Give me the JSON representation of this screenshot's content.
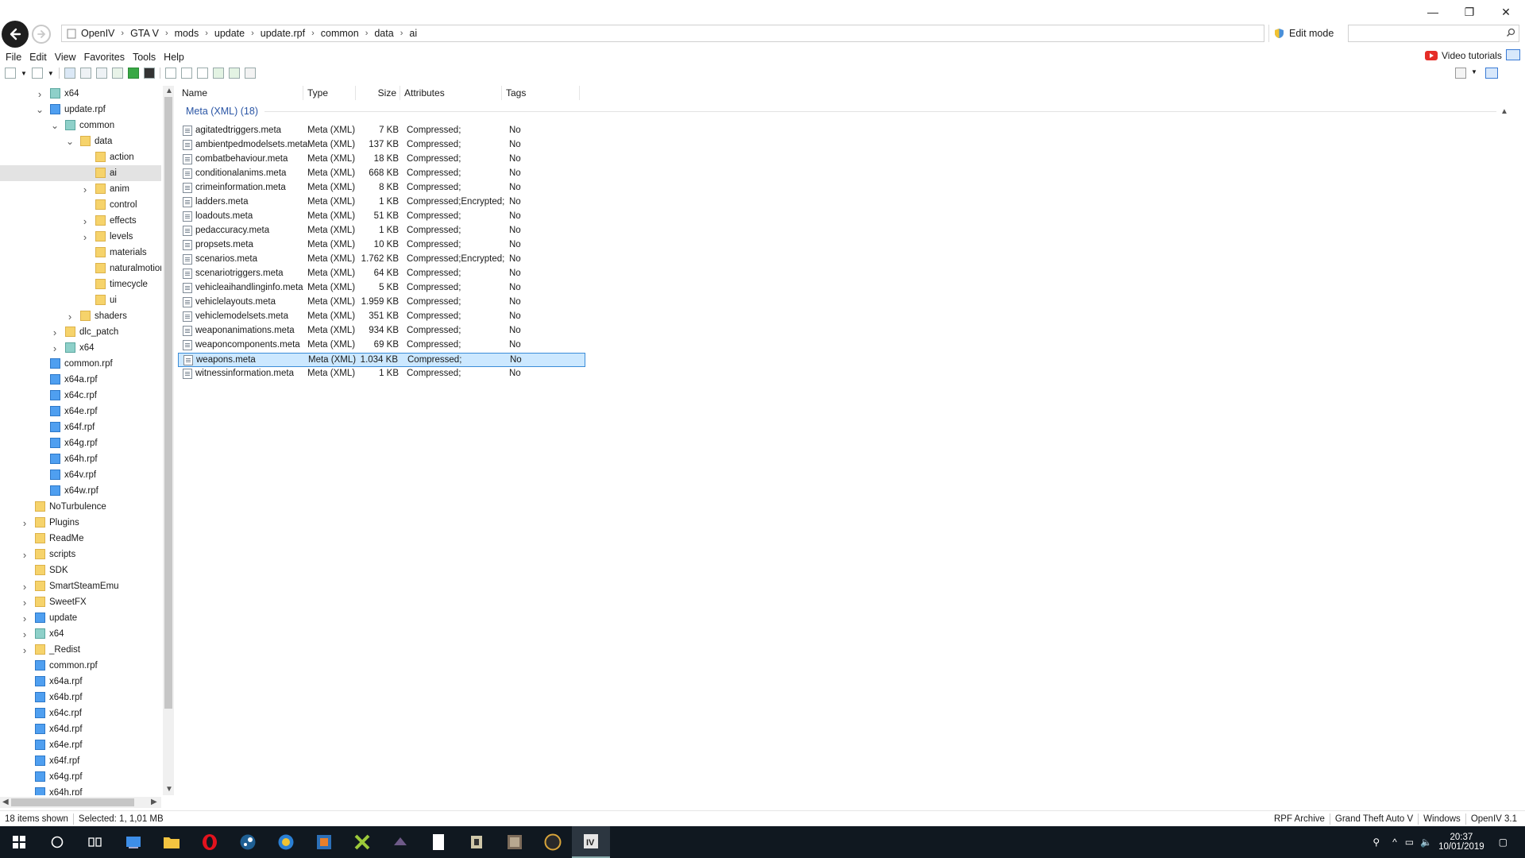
{
  "address": {
    "crumbs": [
      "OpenIV",
      "GTA V",
      "mods",
      "update",
      "update.rpf",
      "common",
      "data",
      "ai"
    ],
    "edit_mode_label": "Edit mode",
    "search_value": ""
  },
  "window_controls": {
    "minimize": "—",
    "restore": "❐",
    "close": "✕"
  },
  "menu": [
    "File",
    "Edit",
    "View",
    "Favorites",
    "Tools",
    "Help"
  ],
  "video_tutorials_label": "Video tutorials",
  "tree": [
    {
      "label": "x64",
      "indent": 1,
      "icon": "teal",
      "chevron": ">"
    },
    {
      "label": "update.rpf",
      "indent": 1,
      "icon": "rpf",
      "chevron": "v"
    },
    {
      "label": "common",
      "indent": 2,
      "icon": "teal",
      "chevron": "v"
    },
    {
      "label": "data",
      "indent": 3,
      "icon": "folder-open",
      "chevron": "v"
    },
    {
      "label": "action",
      "indent": 4,
      "icon": "folder",
      "chevron": ""
    },
    {
      "label": "ai",
      "indent": 4,
      "icon": "folder",
      "chevron": "",
      "selected": true
    },
    {
      "label": "anim",
      "indent": 4,
      "icon": "folder",
      "chevron": ">"
    },
    {
      "label": "control",
      "indent": 4,
      "icon": "folder",
      "chevron": ""
    },
    {
      "label": "effects",
      "indent": 4,
      "icon": "folder",
      "chevron": ">"
    },
    {
      "label": "levels",
      "indent": 4,
      "icon": "grid",
      "chevron": ">"
    },
    {
      "label": "materials",
      "indent": 4,
      "icon": "folder",
      "chevron": ""
    },
    {
      "label": "naturalmotion",
      "indent": 4,
      "icon": "folder",
      "chevron": ""
    },
    {
      "label": "timecycle",
      "indent": 4,
      "icon": "folder",
      "chevron": ""
    },
    {
      "label": "ui",
      "indent": 4,
      "icon": "folder",
      "chevron": ""
    },
    {
      "label": "shaders",
      "indent": 3,
      "icon": "folder",
      "chevron": ">"
    },
    {
      "label": "dlc_patch",
      "indent": 2,
      "icon": "folder",
      "chevron": ">"
    },
    {
      "label": "x64",
      "indent": 2,
      "icon": "teal",
      "chevron": ">"
    },
    {
      "label": "common.rpf",
      "indent": 1,
      "icon": "rpf",
      "chevron": ""
    },
    {
      "label": "x64a.rpf",
      "indent": 1,
      "icon": "rpf",
      "chevron": ""
    },
    {
      "label": "x64c.rpf",
      "indent": 1,
      "icon": "rpf",
      "chevron": ""
    },
    {
      "label": "x64e.rpf",
      "indent": 1,
      "icon": "rpf",
      "chevron": ""
    },
    {
      "label": "x64f.rpf",
      "indent": 1,
      "icon": "rpf",
      "chevron": ""
    },
    {
      "label": "x64g.rpf",
      "indent": 1,
      "icon": "rpf",
      "chevron": ""
    },
    {
      "label": "x64h.rpf",
      "indent": 1,
      "icon": "rpf",
      "chevron": ""
    },
    {
      "label": "x64v.rpf",
      "indent": 1,
      "icon": "rpf",
      "chevron": ""
    },
    {
      "label": "x64w.rpf",
      "indent": 1,
      "icon": "rpf",
      "chevron": ""
    },
    {
      "label": "NoTurbulence",
      "indent": 0,
      "icon": "folder",
      "chevron": ""
    },
    {
      "label": "Plugins",
      "indent": 0,
      "icon": "folder",
      "chevron": ">"
    },
    {
      "label": "ReadMe",
      "indent": 0,
      "icon": "folder",
      "chevron": ""
    },
    {
      "label": "scripts",
      "indent": 0,
      "icon": "folder",
      "chevron": ">"
    },
    {
      "label": "SDK",
      "indent": 0,
      "icon": "folder",
      "chevron": ""
    },
    {
      "label": "SmartSteamEmu",
      "indent": 0,
      "icon": "folder",
      "chevron": ">"
    },
    {
      "label": "SweetFX",
      "indent": 0,
      "icon": "folder",
      "chevron": ">"
    },
    {
      "label": "update",
      "indent": 0,
      "icon": "rpf",
      "chevron": ">"
    },
    {
      "label": "x64",
      "indent": 0,
      "icon": "teal",
      "chevron": ">"
    },
    {
      "label": "_Redist",
      "indent": 0,
      "icon": "folder",
      "chevron": ">"
    },
    {
      "label": "common.rpf",
      "indent": 0,
      "icon": "rpf",
      "chevron": ""
    },
    {
      "label": "x64a.rpf",
      "indent": 0,
      "icon": "rpf",
      "chevron": ""
    },
    {
      "label": "x64b.rpf",
      "indent": 0,
      "icon": "rpf",
      "chevron": ""
    },
    {
      "label": "x64c.rpf",
      "indent": 0,
      "icon": "rpf",
      "chevron": ""
    },
    {
      "label": "x64d.rpf",
      "indent": 0,
      "icon": "rpf",
      "chevron": ""
    },
    {
      "label": "x64e.rpf",
      "indent": 0,
      "icon": "rpf",
      "chevron": ""
    },
    {
      "label": "x64f.rpf",
      "indent": 0,
      "icon": "rpf",
      "chevron": ""
    },
    {
      "label": "x64g.rpf",
      "indent": 0,
      "icon": "rpf",
      "chevron": ""
    },
    {
      "label": "x64h.rpf",
      "indent": 0,
      "icon": "rpf",
      "chevron": ""
    }
  ],
  "columns": [
    "Name",
    "Type",
    "Size",
    "Attributes",
    "Tags"
  ],
  "group_title": "Meta (XML) (18)",
  "files": [
    {
      "name": "agitatedtriggers.meta",
      "type": "Meta (XML)",
      "size": "7 KB",
      "attributes": "Compressed;",
      "tags": "No"
    },
    {
      "name": "ambientpedmodelsets.meta",
      "type": "Meta (XML)",
      "size": "137 KB",
      "attributes": "Compressed;",
      "tags": "No"
    },
    {
      "name": "combatbehaviour.meta",
      "type": "Meta (XML)",
      "size": "18 KB",
      "attributes": "Compressed;",
      "tags": "No"
    },
    {
      "name": "conditionalanims.meta",
      "type": "Meta (XML)",
      "size": "668 KB",
      "attributes": "Compressed;",
      "tags": "No"
    },
    {
      "name": "crimeinformation.meta",
      "type": "Meta (XML)",
      "size": "8 KB",
      "attributes": "Compressed;",
      "tags": "No"
    },
    {
      "name": "ladders.meta",
      "type": "Meta (XML)",
      "size": "1 KB",
      "attributes": "Compressed;Encrypted;",
      "tags": "No"
    },
    {
      "name": "loadouts.meta",
      "type": "Meta (XML)",
      "size": "51 KB",
      "attributes": "Compressed;",
      "tags": "No"
    },
    {
      "name": "pedaccuracy.meta",
      "type": "Meta (XML)",
      "size": "1 KB",
      "attributes": "Compressed;",
      "tags": "No"
    },
    {
      "name": "propsets.meta",
      "type": "Meta (XML)",
      "size": "10 KB",
      "attributes": "Compressed;",
      "tags": "No"
    },
    {
      "name": "scenarios.meta",
      "type": "Meta (XML)",
      "size": "1.762 KB",
      "attributes": "Compressed;Encrypted;",
      "tags": "No"
    },
    {
      "name": "scenariotriggers.meta",
      "type": "Meta (XML)",
      "size": "64 KB",
      "attributes": "Compressed;",
      "tags": "No"
    },
    {
      "name": "vehicleaihandlinginfo.meta",
      "type": "Meta (XML)",
      "size": "5 KB",
      "attributes": "Compressed;",
      "tags": "No"
    },
    {
      "name": "vehiclelayouts.meta",
      "type": "Meta (XML)",
      "size": "1.959 KB",
      "attributes": "Compressed;",
      "tags": "No"
    },
    {
      "name": "vehiclemodelsets.meta",
      "type": "Meta (XML)",
      "size": "351 KB",
      "attributes": "Compressed;",
      "tags": "No"
    },
    {
      "name": "weaponanimations.meta",
      "type": "Meta (XML)",
      "size": "934 KB",
      "attributes": "Compressed;",
      "tags": "No"
    },
    {
      "name": "weaponcomponents.meta",
      "type": "Meta (XML)",
      "size": "69 KB",
      "attributes": "Compressed;",
      "tags": "No"
    },
    {
      "name": "weapons.meta",
      "type": "Meta (XML)",
      "size": "1.034 KB",
      "attributes": "Compressed;",
      "tags": "No",
      "selected": true
    },
    {
      "name": "witnessinformation.meta",
      "type": "Meta (XML)",
      "size": "1 KB",
      "attributes": "Compressed;",
      "tags": "No"
    }
  ],
  "status": {
    "items_shown": "18 items shown",
    "selected": "Selected: 1,  1,01 MB",
    "archive": "RPF Archive",
    "game": "Grand Theft Auto V",
    "platform": "Windows",
    "version": "OpenIV 3.1"
  },
  "taskbar": {
    "time": "20:37",
    "date": "10/01/2019",
    "apps": [
      "start-icon",
      "cortana-icon",
      "task-view-icon",
      "explorer-app-icon",
      "folder-app-icon",
      "opera-icon",
      "steam-icon",
      "app-globe-icon",
      "app-blue-icon",
      "app-gtav-icon",
      "app-dark-icon",
      "notepad-icon",
      "app-gear-icon",
      "app-game-icon",
      "app-round-icon",
      "openiv-icon"
    ]
  },
  "colors": {
    "accent": "#2a55a5",
    "selection": "#cce8ff",
    "selection_border": "#3a8cd8",
    "taskbar": "#101820"
  }
}
